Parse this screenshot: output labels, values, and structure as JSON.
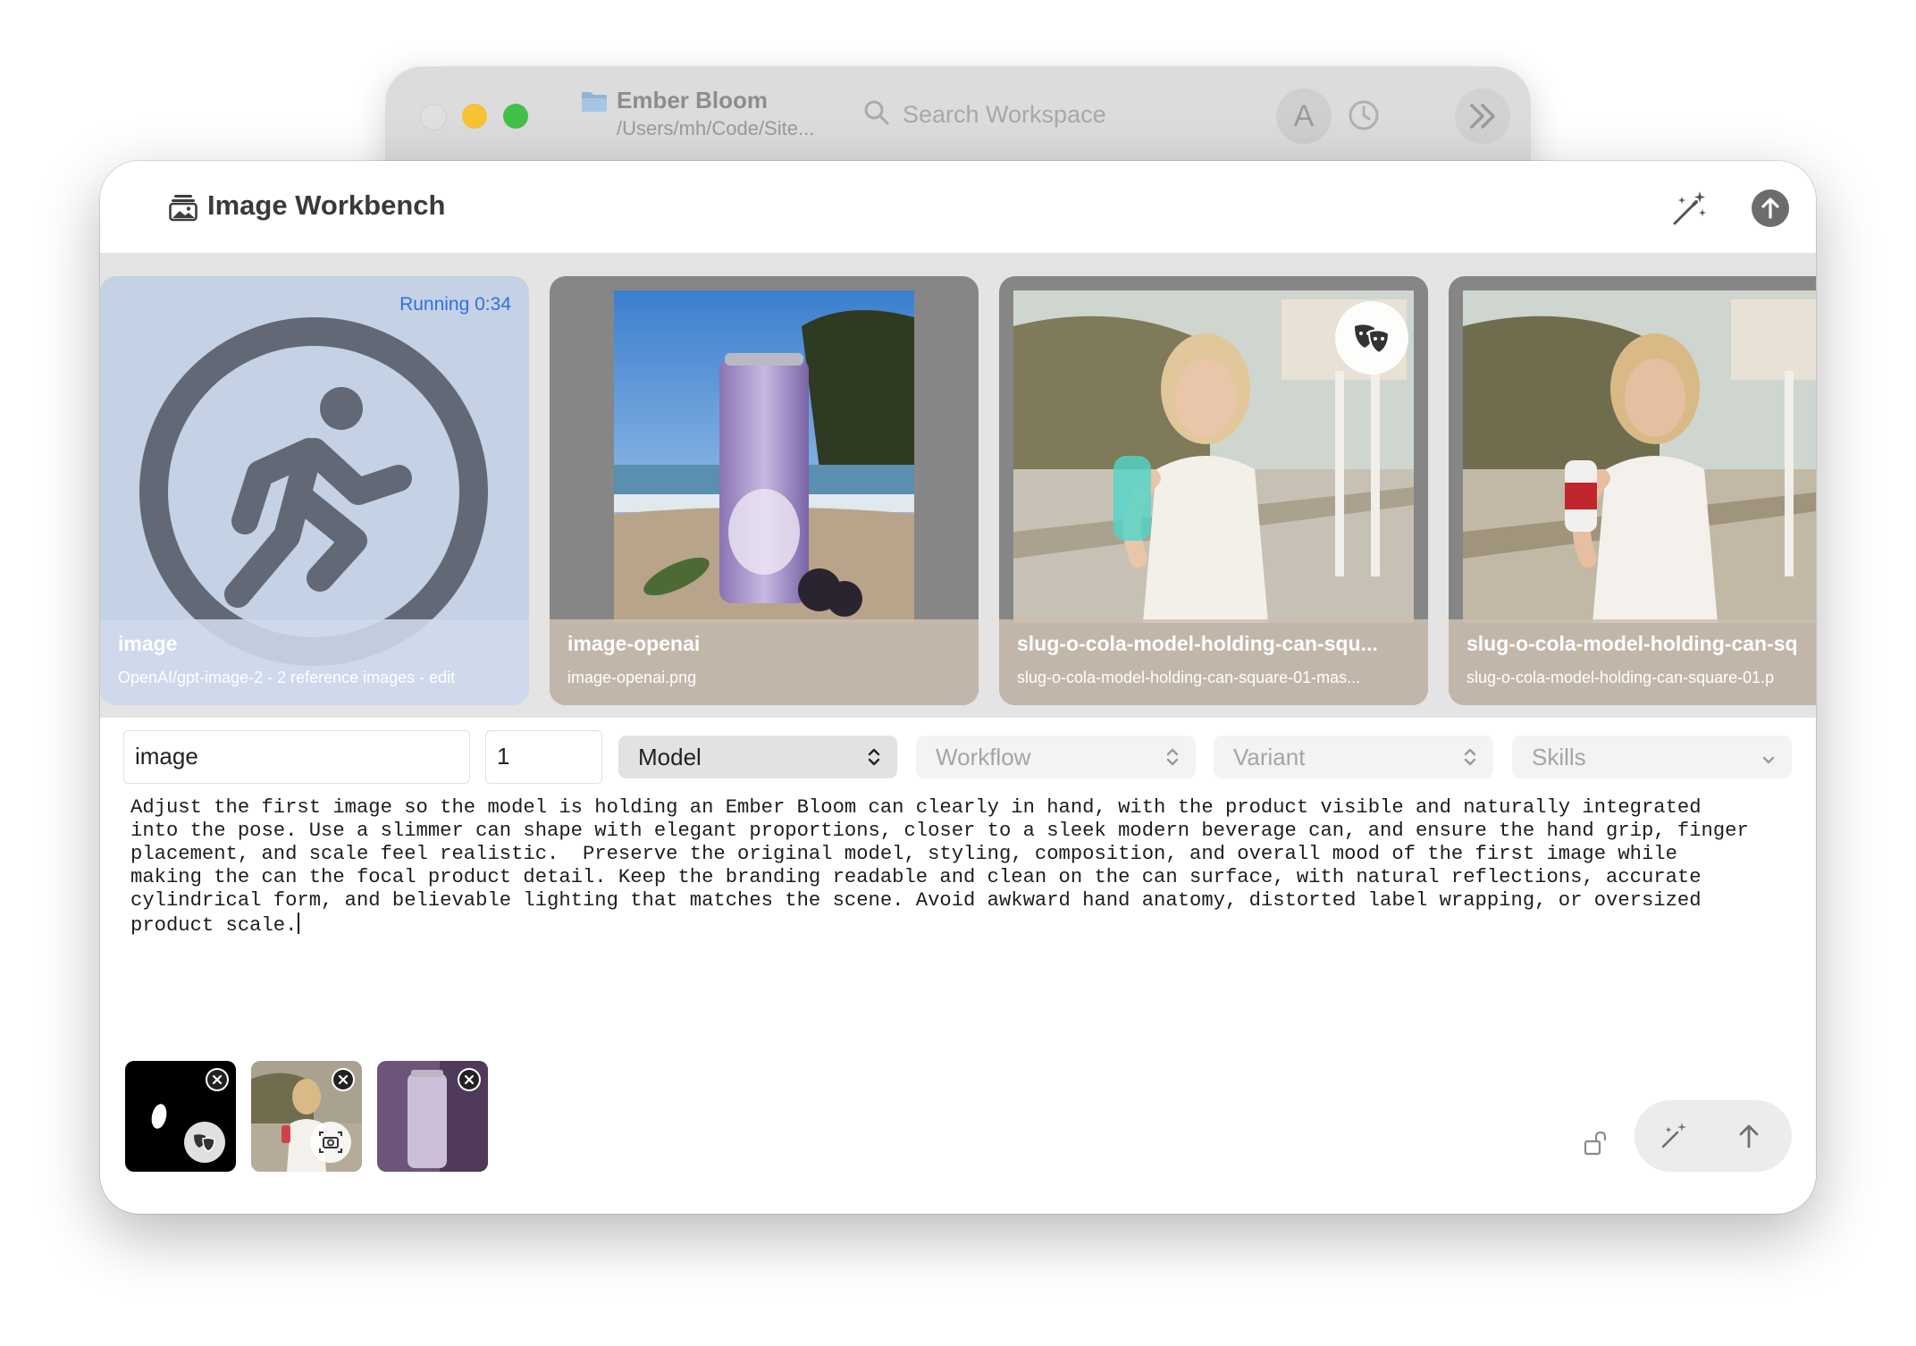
{
  "background_window": {
    "project_name": "Ember Bloom",
    "project_path": "/Users/mh/Code/Site...",
    "search_placeholder": "Search Workspace",
    "avatar_initial": "A"
  },
  "main_window": {
    "title": "Image Workbench"
  },
  "gallery": {
    "cards": [
      {
        "title": "image",
        "subtitle": "OpenAI/gpt-image-2 - 2 reference images - edit",
        "status": "Running 0:34",
        "icon": "running-person-icon"
      },
      {
        "title": "image-openai",
        "subtitle": "image-openai.png",
        "image": "ember-bloom-can-beach"
      },
      {
        "title": "slug-o-cola-model-holding-can-squ...",
        "subtitle": "slug-o-cola-model-holding-can-square-01-mas...",
        "image": "model-holding-can-masked",
        "badge_icon": "theater-masks-icon"
      },
      {
        "title": "slug-o-cola-model-holding-can-sq",
        "subtitle": "slug-o-cola-model-holding-can-square-01.p",
        "image": "model-holding-can"
      }
    ]
  },
  "form": {
    "name_value": "image",
    "count_value": "1",
    "model_label": "Model",
    "workflow_label": "Workflow",
    "variant_label": "Variant",
    "skills_label": "Skills",
    "prompt_text": "Adjust the first image so the model is holding an Ember Bloom can clearly in hand, with the product visible and naturally integrated\ninto the pose. Use a slimmer can shape with elegant proportions, closer to a sleek modern beverage can, and ensure the hand grip, finger\nplacement, and scale feel realistic.  Preserve the original model, styling, composition, and overall mood of the first image while\nmaking the can the focal product detail. Keep the branding readable and clean on the can surface, with natural reflections, accurate\ncylindrical form, and believable lighting that matches the scene. Avoid awkward hand anatomy, distorted label wrapping, or oversized\nproduct scale."
  },
  "attachments": [
    {
      "kind": "mask",
      "badge_icon": "theater-masks-icon"
    },
    {
      "kind": "photo",
      "badge_icon": "camera-viewfinder-icon"
    },
    {
      "kind": "product"
    }
  ],
  "colors": {
    "running_text": "#2f6fe6",
    "running_card_bg": "#c5d1e4",
    "traffic_yellow": "#f7c234",
    "traffic_green": "#43c04c"
  }
}
